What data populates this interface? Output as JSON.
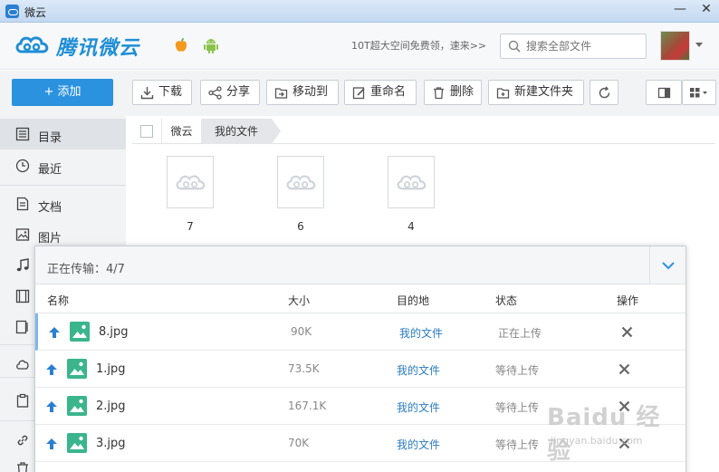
{
  "window": {
    "title": "微云",
    "minimize": "—",
    "close": "✕"
  },
  "header": {
    "logo_text": "腾讯微云",
    "promo": "10T超大空间免费领，速来>>",
    "search": {
      "placeholder": "搜索全部文件",
      "value": ""
    }
  },
  "toolbar": {
    "add_label": "+ 添加",
    "download": "下载",
    "share": "分享",
    "move": "移动到",
    "rename": "重命名",
    "delete": "删除",
    "new_folder": "新建文件夹"
  },
  "sidebar": {
    "items": [
      {
        "label": "目录",
        "icon": "list-icon"
      },
      {
        "label": "最近",
        "icon": "clock-icon"
      },
      {
        "label": "文档",
        "icon": "document-icon"
      },
      {
        "label": "图片",
        "icon": "image-icon"
      }
    ]
  },
  "breadcrumb": [
    "微云",
    "我的文件"
  ],
  "files": [
    {
      "name": "7"
    },
    {
      "name": "6"
    },
    {
      "name": "4"
    }
  ],
  "transfer": {
    "title": "正在传输：4/7",
    "columns": {
      "name": "名称",
      "size": "大小",
      "dest": "目的地",
      "status": "状态",
      "action": "操作"
    },
    "rows": [
      {
        "name": "8.jpg",
        "size": "90K",
        "dest": "我的文件",
        "status": "正在上传"
      },
      {
        "name": "1.jpg",
        "size": "73.5K",
        "dest": "我的文件",
        "status": "等待上传"
      },
      {
        "name": "2.jpg",
        "size": "167.1K",
        "dest": "我的文件",
        "status": "等待上传"
      },
      {
        "name": "3.jpg",
        "size": "70K",
        "dest": "我的文件",
        "status": "等待上传"
      }
    ]
  },
  "watermark": {
    "line1": "Baidu 经验",
    "line2": "jingyan.baidu.com"
  },
  "colors": {
    "accent": "#2b92e0",
    "logo": "#1f8ed6",
    "link": "#2b7cc1"
  }
}
